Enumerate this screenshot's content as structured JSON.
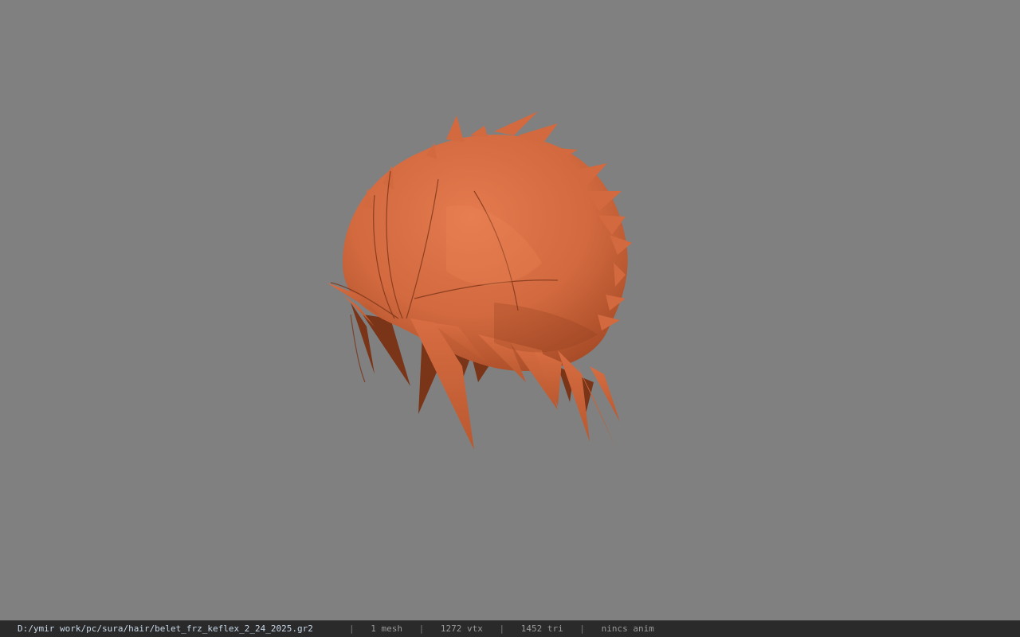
{
  "viewport": {
    "background_color": "#808080",
    "model": {
      "subject": "hair mesh",
      "base_color": "#d2693f",
      "shadow_color": "#7a3418",
      "highlight_color": "#e47a4e"
    }
  },
  "status_bar": {
    "file_path": "D:/ymir work/pc/sura/hair/belet_frz_keflex_2_24_2025.gr2",
    "separator": "|",
    "mesh_count": "1 mesh",
    "vertex_count": "1272 vtx",
    "triangle_count": "1452 tri",
    "anim_status": "nincs anim",
    "path_color": "#c9d8e8",
    "text_color": "#9a9a9a"
  }
}
